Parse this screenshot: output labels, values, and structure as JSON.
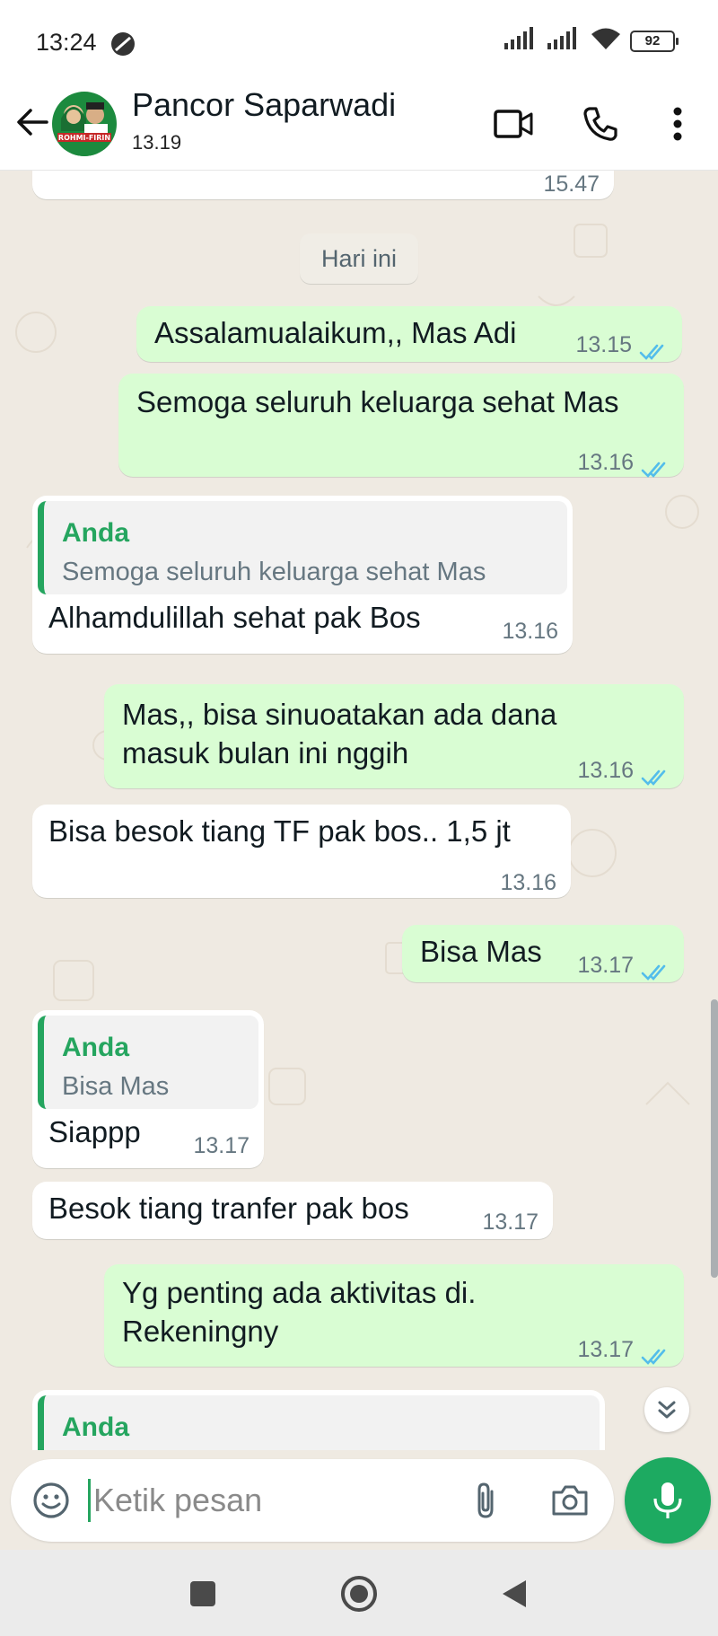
{
  "status_bar": {
    "time": "13:24",
    "battery": "92",
    "icons": [
      "dnd-icon",
      "signal-icon",
      "signal-icon",
      "wifi-icon",
      "battery-icon"
    ]
  },
  "header": {
    "name": "Pancor Saparwadi",
    "subtitle": "13.19",
    "avatar_text": "ROHMI-FIRIN",
    "icons": [
      "back-arrow-icon",
      "video-call-icon",
      "voice-call-icon",
      "more-vert-icon"
    ]
  },
  "chat": {
    "prev_time": "15.47",
    "date_label": "Hari ini",
    "messages": [
      {
        "dir": "out",
        "text": "Assalamualaikum,, Mas Adi",
        "time": "13.15",
        "status": "read"
      },
      {
        "dir": "out",
        "text": "Semoga seluruh keluarga sehat Mas",
        "time": "13.16",
        "status": "read"
      },
      {
        "dir": "in",
        "quote_name": "Anda",
        "quote_text": "Semoga seluruh keluarga sehat Mas",
        "text": "Alhamdulillah sehat pak Bos",
        "time": "13.16"
      },
      {
        "dir": "out",
        "text_lines": [
          "Mas,, bisa sinuoatakan ada dana",
          "masuk bulan ini nggih"
        ],
        "time": "13.16",
        "status": "read"
      },
      {
        "dir": "in",
        "text": "Bisa besok tiang TF pak bos.. 1,5 jt",
        "time": "13.16"
      },
      {
        "dir": "out",
        "text": "Bisa Mas",
        "time": "13.17",
        "status": "read"
      },
      {
        "dir": "in",
        "quote_name": "Anda",
        "quote_text": "Bisa Mas",
        "text": "Siappp",
        "time": "13.17"
      },
      {
        "dir": "in",
        "text": "Besok tiang tranfer pak bos",
        "time": "13.17"
      },
      {
        "dir": "out",
        "text_lines": [
          "Yg penting ada aktivitas di.",
          "Rekeningny"
        ],
        "time": "13.17",
        "status": "read"
      },
      {
        "dir": "in",
        "quote_name": "Anda"
      }
    ]
  },
  "composer": {
    "placeholder": "Ketik pesan",
    "icons": [
      "emoji-icon",
      "attach-icon",
      "camera-icon",
      "mic-icon"
    ]
  },
  "nav": {
    "icons": [
      "recents-square-icon",
      "home-circle-icon",
      "back-triangle-icon"
    ]
  },
  "colors": {
    "accent": "#25a55f",
    "outgoing": "#d9fdd3",
    "incoming": "#ffffff",
    "background": "#efeae2",
    "read_ticks": "#53bdeb"
  }
}
